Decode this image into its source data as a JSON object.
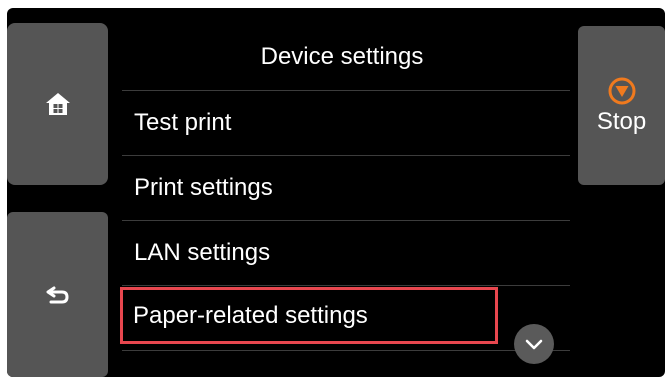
{
  "header": {
    "title": "Device settings"
  },
  "menu": {
    "items": [
      {
        "label": "Test print"
      },
      {
        "label": "Print settings"
      },
      {
        "label": "LAN settings"
      },
      {
        "label": "Paper-related settings",
        "highlighted": true
      }
    ]
  },
  "stop": {
    "label": "Stop"
  },
  "icons": {
    "home": "home-icon",
    "back": "back-icon",
    "stop": "stop-icon",
    "scroll_down": "chevron-down-icon"
  },
  "colors": {
    "panel_background": "#000000",
    "side_button": "#555555",
    "stop_accent": "#f07a1e",
    "highlight_border": "#e8474f",
    "text": "#ffffff"
  }
}
